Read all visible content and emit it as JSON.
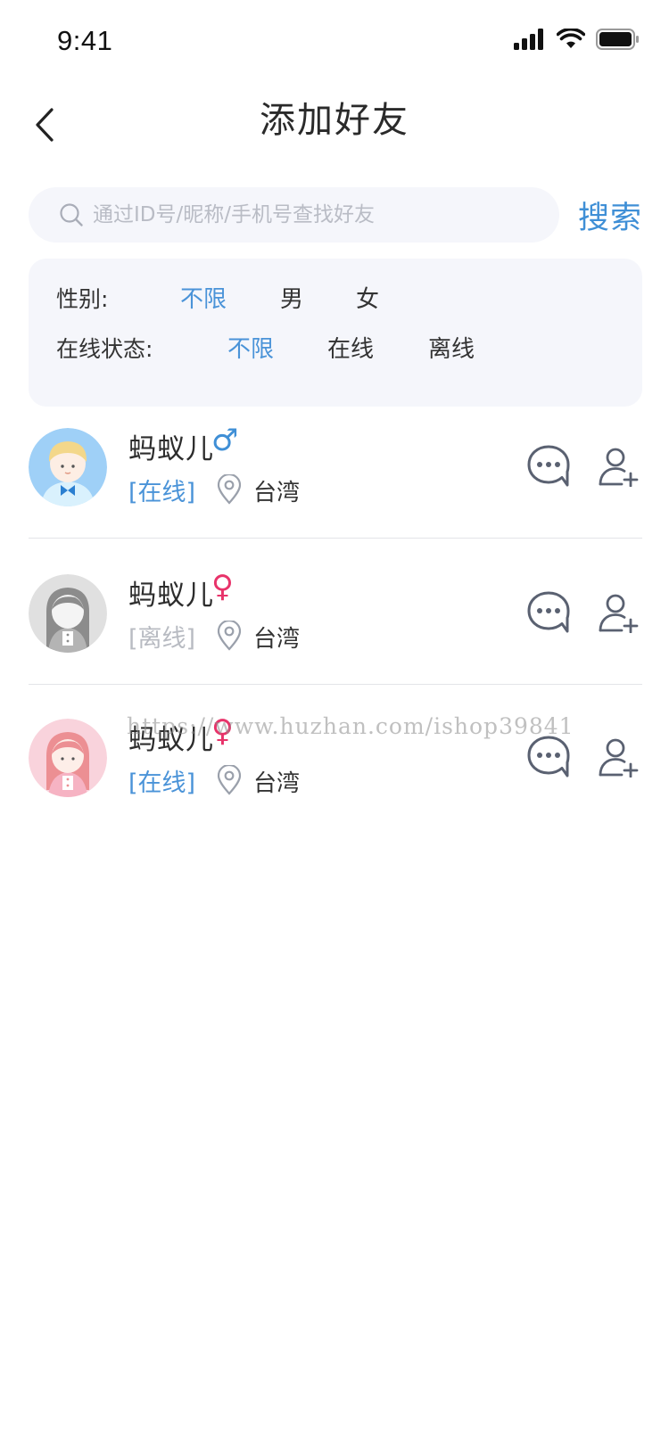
{
  "status_bar": {
    "time": "9:41"
  },
  "nav": {
    "title": "添加好友"
  },
  "search": {
    "placeholder": "通过ID号/昵称/手机号查找好友",
    "button_label": "搜索"
  },
  "filters": {
    "gender_label": "性别:",
    "gender_options": [
      "不限",
      "男",
      "女"
    ],
    "gender_selected": "不限",
    "status_label": "在线状态:",
    "status_options": [
      "不限",
      "在线",
      "离线"
    ],
    "status_selected": "不限"
  },
  "users": [
    {
      "name": "蚂蚁儿",
      "gender_symbol": "♂",
      "gender_color": "#3f8fd6",
      "status": "[在线]",
      "status_color": "#4a93d8",
      "location": "台湾",
      "avatar": "boy-avatar"
    },
    {
      "name": "蚂蚁儿",
      "gender_symbol": "♀",
      "gender_color": "#e8336a",
      "status": "[离线]",
      "status_color": "#b8bbc2",
      "location": "台湾",
      "avatar": "grey-girl-avatar"
    },
    {
      "name": "蚂蚁儿",
      "gender_symbol": "♀",
      "gender_color": "#e8336a",
      "status": "[在线]",
      "status_color": "#4a93d8",
      "location": "台湾",
      "avatar": "pink-girl-avatar"
    }
  ],
  "watermark": "https://www.huzhan.com/ishop39841",
  "colors": {
    "accent": "#4a93d8",
    "male": "#3f8fd6",
    "female": "#e8336a",
    "panel_bg": "#f5f6fb"
  }
}
